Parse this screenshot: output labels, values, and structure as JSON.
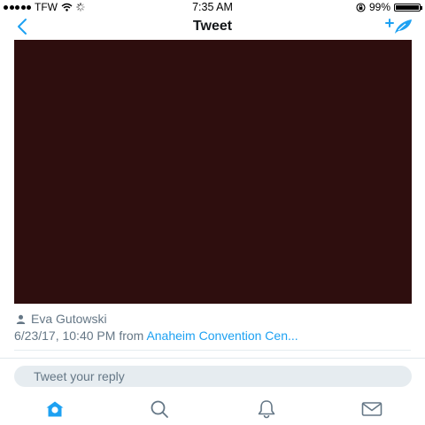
{
  "status": {
    "carrier": "TFW",
    "time": "7:35 AM",
    "battery": "99%",
    "battery_level": 0.99,
    "signal_icon": "signal-dots-icon",
    "wifi_icon": "wifi-icon",
    "activity_icon": "activity-spinner-icon",
    "lock_icon": "rotation-lock-icon"
  },
  "nav": {
    "title": "Tweet",
    "back_icon": "back-chevron-icon",
    "compose_icon": "compose-tweet-icon"
  },
  "tweet": {
    "author": "Eva Gutowski",
    "timestamp": "6/23/17, 10:40 PM",
    "from_text": "from",
    "location": "Anaheim Convention Cen..."
  },
  "reply": {
    "placeholder": "Tweet your reply"
  },
  "tabbar": {
    "items": [
      "home-icon",
      "search-icon",
      "notifications-icon",
      "messages-icon"
    ],
    "accent": "#1da1f2",
    "inactive": "#657786"
  },
  "colors": {
    "accent": "#1da1f2",
    "media_bg": "#2e0e0e",
    "muted_text": "#657786"
  }
}
